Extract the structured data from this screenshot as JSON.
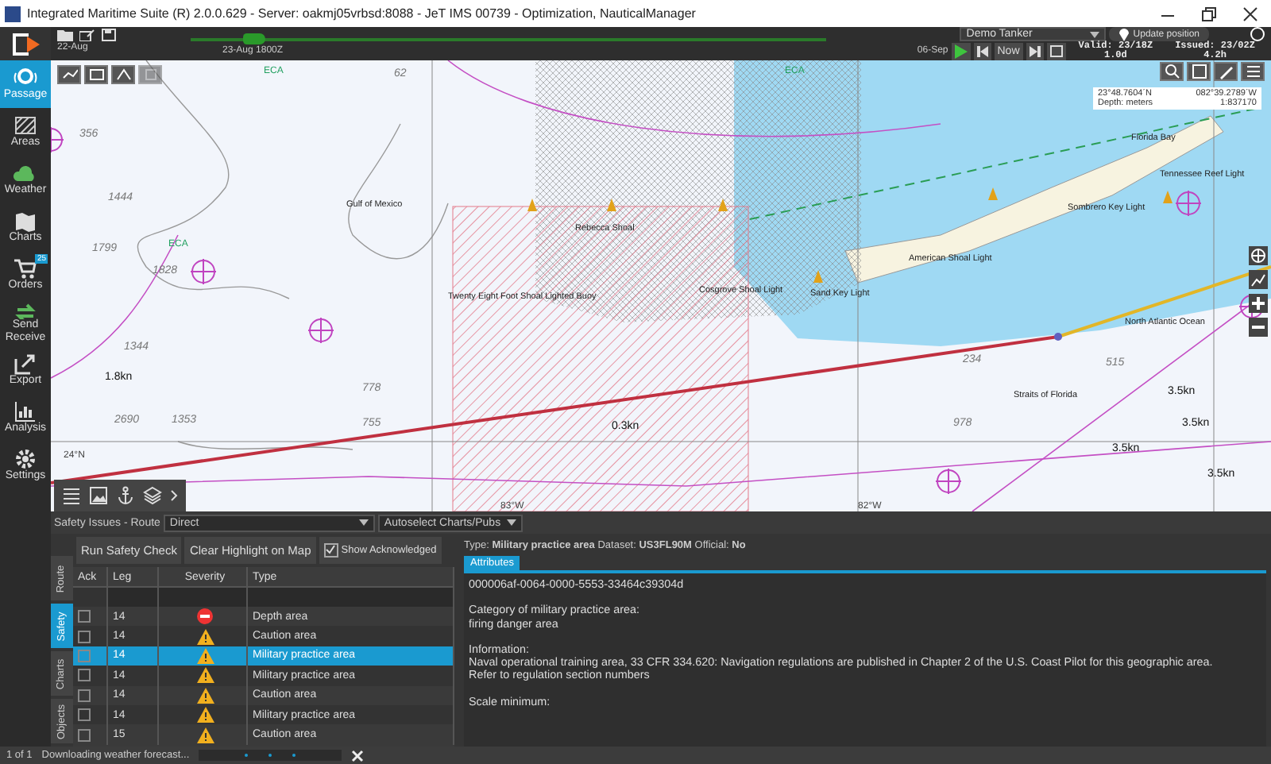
{
  "window": {
    "title": "Integrated Maritime Suite (R) 2.0.0.629 - Server: oakmj05vrbsd:8088 - JeT IMS 00739 - Optimization, NauticalManager"
  },
  "sidebar": {
    "items": [
      {
        "label": "Passage",
        "kind": "passage",
        "selected": true
      },
      {
        "label": "Areas",
        "kind": "areas",
        "selected": false
      },
      {
        "label": "Weather",
        "kind": "weather",
        "selected": false
      },
      {
        "label": "Charts",
        "kind": "charts",
        "selected": false
      },
      {
        "label": "Orders",
        "kind": "orders",
        "selected": false,
        "badge": "25"
      },
      {
        "label": "Send Receive",
        "kind": "send",
        "selected": false
      },
      {
        "label": "Export",
        "kind": "export",
        "selected": false
      },
      {
        "label": "Analysis",
        "kind": "analysis",
        "selected": false
      },
      {
        "label": "Settings",
        "kind": "settings",
        "selected": false
      }
    ]
  },
  "timeline": {
    "start": "22-Aug",
    "current": "23-Aug 1800Z",
    "end": "06-Sep",
    "level": 0.1,
    "now_button": "Now",
    "valid": "Valid: 23/18Z",
    "valid_span": "1.0d",
    "issued": "Issued: 23/02Z",
    "issued_span": "4.2h",
    "vessel": "Demo Tanker",
    "update_button": "Update position"
  },
  "map": {
    "info": {
      "lat": "23°48.7604´N",
      "lon": "082°39.2789´W",
      "depth": "Depth: meters",
      "scale": "1:837170"
    },
    "labels": [
      {
        "text": "Gulf of Mexico",
        "kind": "place"
      },
      {
        "text": "Rebecca Shoal",
        "kind": "place"
      },
      {
        "text": "Cosgrove Shoal Light",
        "kind": "place"
      },
      {
        "text": "Twenty Eight Foot Shoal Lighted Buoy",
        "kind": "place"
      },
      {
        "text": "Sand Key Light",
        "kind": "place"
      },
      {
        "text": "American Shoal Light",
        "kind": "place"
      },
      {
        "text": "Florida Bay",
        "kind": "place"
      },
      {
        "text": "Tennessee Reef Light",
        "kind": "place"
      },
      {
        "text": "Sombrero Key Light",
        "kind": "place"
      },
      {
        "text": "North Atlantic Ocean",
        "kind": "place"
      },
      {
        "text": "Straits of Florida",
        "kind": "place"
      },
      {
        "text": "1.8kn",
        "kind": "current"
      },
      {
        "text": "0.3kn",
        "kind": "current"
      },
      {
        "text": "3.5kn",
        "kind": "current"
      },
      {
        "text": "3.5kn",
        "kind": "current"
      },
      {
        "text": "3.5kn",
        "kind": "current"
      },
      {
        "text": "3.5kn",
        "kind": "current"
      },
      {
        "text": "24°N",
        "kind": "grid"
      },
      {
        "text": "83°W",
        "kind": "grid"
      },
      {
        "text": "82°W",
        "kind": "grid"
      },
      {
        "text": "ECA",
        "kind": "zone"
      },
      {
        "text": "ECA",
        "kind": "zone"
      },
      {
        "text": "ECA",
        "kind": "zone"
      },
      {
        "text": "356",
        "kind": "depth"
      },
      {
        "text": "1444",
        "kind": "depth"
      },
      {
        "text": "1828",
        "kind": "depth"
      },
      {
        "text": "1799",
        "kind": "depth"
      },
      {
        "text": "1344",
        "kind": "depth"
      },
      {
        "text": "2690",
        "kind": "depth"
      },
      {
        "text": "1353",
        "kind": "depth"
      },
      {
        "text": "62",
        "kind": "depth"
      },
      {
        "text": "778",
        "kind": "depth"
      },
      {
        "text": "755",
        "kind": "depth"
      },
      {
        "text": "515",
        "kind": "depth"
      },
      {
        "text": "234",
        "kind": "depth"
      },
      {
        "text": "978",
        "kind": "depth"
      }
    ]
  },
  "safety": {
    "label": "Safety Issues - Route",
    "route": "Direct",
    "autoselect": "Autoselect Charts/Pubs",
    "tabs": [
      {
        "label": "Route",
        "selected": false
      },
      {
        "label": "Safety",
        "selected": true
      },
      {
        "label": "Charts",
        "selected": false
      },
      {
        "label": "Objects",
        "selected": false
      }
    ],
    "run_button": "Run Safety Check",
    "clear_button": "Clear Highlight on Map",
    "show_acknowledged": {
      "label": "Show Acknowledged",
      "checked": true
    },
    "columns": [
      "Ack",
      "Leg",
      "Severity",
      "Type"
    ],
    "rows": [
      {
        "ack": false,
        "leg": "14",
        "kind": "error",
        "type": "Depth area",
        "selected": false
      },
      {
        "ack": false,
        "leg": "14",
        "kind": "warning",
        "type": "Caution area",
        "selected": false
      },
      {
        "ack": false,
        "leg": "14",
        "kind": "warning",
        "type": "Military practice area",
        "selected": true
      },
      {
        "ack": false,
        "leg": "14",
        "kind": "warning",
        "type": "Military practice area",
        "selected": false
      },
      {
        "ack": false,
        "leg": "14",
        "kind": "warning",
        "type": "Caution area",
        "selected": false
      },
      {
        "ack": false,
        "leg": "14",
        "kind": "warning",
        "type": "Military practice area",
        "selected": false
      },
      {
        "ack": false,
        "leg": "15",
        "kind": "warning",
        "type": "Caution area",
        "selected": false
      }
    ],
    "detail": {
      "summary": "Type: **Military practice area** Dataset: **US3FL90M** Official: **No**",
      "tab": "Attributes",
      "paragraphs": [
        [
          "000006af-0064-0000-5553-33464c39304d"
        ],
        [
          "Category of military practice area:",
          "firing danger area"
        ],
        [
          "Information:",
          "Naval operational training area, 33 CFR 334.620: Navigation regulations are published in Chapter 2 of the U.S. Coast Pilot for this geographic area.",
          "Refer to regulation section numbers"
        ],
        [
          "Scale minimum:"
        ]
      ]
    }
  },
  "status_bar": {
    "page": "1 of 1",
    "message": "Downloading weather forecast..."
  }
}
